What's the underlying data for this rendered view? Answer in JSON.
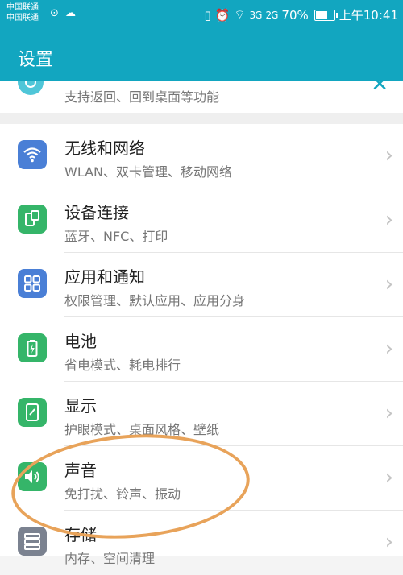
{
  "status_bar": {
    "carrier_1": "中国联通",
    "carrier_2": "中国联通",
    "left_icons": "⊙ ☁",
    "vibrate": "▯",
    "alarm": "⏰",
    "wifi": "⌔",
    "signal_1": "3G",
    "signal_2": "2G",
    "battery_percent": "70%",
    "battery_level": 70,
    "time": "上午10:41"
  },
  "app_bar": {
    "title": "设置"
  },
  "partial_item": {
    "subtitle": "支持返回、回到桌面等功能",
    "close_icon": "✕"
  },
  "items": [
    {
      "label": "无线和网络",
      "subtitle": "WLAN、双卡管理、移动网络",
      "icon": "wifi-icon",
      "color": "#4a7fd6"
    },
    {
      "label": "设备连接",
      "subtitle": "蓝牙、NFC、打印",
      "icon": "device-connection-icon",
      "color": "#35b569"
    },
    {
      "label": "应用和通知",
      "subtitle": "权限管理、默认应用、应用分身",
      "icon": "apps-icon",
      "color": "#4a7fd6"
    },
    {
      "label": "电池",
      "subtitle": "省电模式、耗电排行",
      "icon": "battery-icon",
      "color": "#35b569"
    },
    {
      "label": "显示",
      "subtitle": "护眼模式、桌面风格、壁纸",
      "icon": "display-icon",
      "color": "#35b569"
    },
    {
      "label": "声音",
      "subtitle": "免打扰、铃声、振动",
      "icon": "sound-icon",
      "color": "#35b569"
    },
    {
      "label": "存储",
      "subtitle": "内存、空间清理",
      "icon": "storage-icon",
      "color": "#7b8290"
    }
  ],
  "chevron": "›",
  "colors": {
    "header": "#12a6c0",
    "annotation": "#e8a35a"
  }
}
